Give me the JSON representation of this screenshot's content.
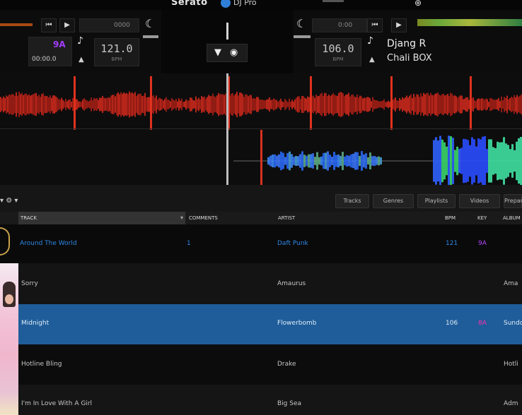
{
  "app": {
    "brand": "Serato",
    "brand_sub": "DJ Pro",
    "top_glyph": "⊕"
  },
  "colors": {
    "accent_blue": "#2e86e6",
    "selected_row": "#1f5d9a",
    "waveform_red": "#c8281c",
    "key_violet": "#b347ff",
    "key_pink": "#ff2fb0"
  },
  "deck1": {
    "btn_prev": "⏮",
    "btn_play": "▶",
    "tag_top": "0000",
    "key_badge": "9A",
    "sub_text": "00:00.0",
    "bpm": "121.0",
    "bpm_label": "BPM",
    "moon": "☾",
    "note": "♪",
    "arrow_up": "▲"
  },
  "deck2": {
    "moon": "☾",
    "tag_top": "0:00",
    "btn_prev": "⏮",
    "btn_play": "▶",
    "bpm": "106.0",
    "bpm_label": "BPM",
    "note": "♪",
    "arrow_up": "▲",
    "track_title": "Djang R",
    "track_artist": "Chali BOX"
  },
  "center": {
    "icon_left": "▼",
    "icon_right": "◉"
  },
  "library": {
    "crate_dropdown": "▾ ⚙ ▾",
    "tabs": [
      "Tracks",
      "Genres",
      "Playlists",
      "Videos",
      "Prepare"
    ],
    "columns": [
      {
        "label": "TRACK"
      },
      {
        "label": "COMMENTS"
      },
      {
        "label": "ARTIST"
      },
      {
        "label": "BPM"
      },
      {
        "label": "KEY"
      },
      {
        "label": "ALBUM"
      }
    ],
    "sort_indicator": "▾",
    "rows": [
      {
        "track": "Around The World",
        "comment": "1",
        "artist": "Daft Punk",
        "bpm": "121",
        "key": "9A",
        "album": ""
      },
      {
        "track": "Sorry",
        "comment": "",
        "artist": "Amaurus",
        "bpm": "",
        "key": "",
        "album": "Ama"
      },
      {
        "track": "Midnight",
        "comment": "",
        "artist": "Flowerbomb",
        "bpm": "106",
        "key": "8A",
        "album": "Sundo"
      },
      {
        "track": "Hotline Bling",
        "comment": "",
        "artist": "Drake",
        "bpm": "",
        "key": "",
        "album": "Hotli"
      },
      {
        "track": "I'm In Love With A Girl",
        "comment": "",
        "artist": "Big Sea",
        "bpm": "",
        "key": "",
        "album": "Adm"
      }
    ]
  }
}
